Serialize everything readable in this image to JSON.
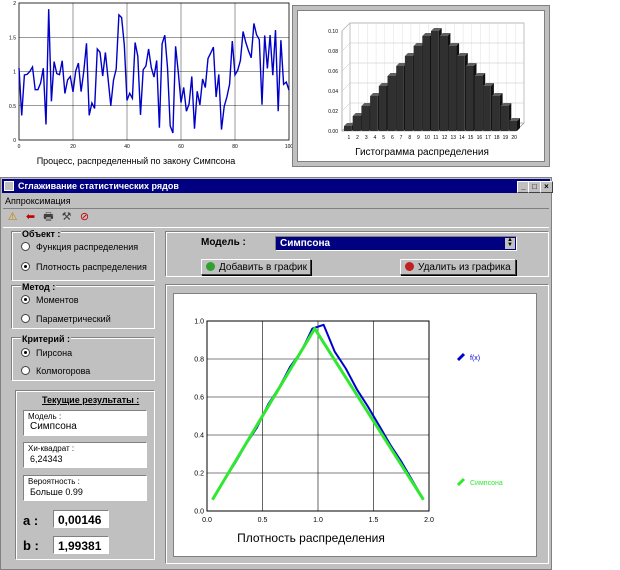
{
  "process_chart": {
    "caption": "Процесс, распределенный по закону Симпсона",
    "yticks": [
      "0",
      "0.5",
      "1",
      "1.5",
      "2"
    ],
    "xticks": [
      "0",
      "20",
      "40",
      "60",
      "80",
      "100"
    ],
    "line_color": "#0000c8"
  },
  "histogram": {
    "caption": "Гистограмма распределения",
    "yticks": [
      "0.00",
      "0.02",
      "0.04",
      "0.06",
      "0.08",
      "0.10"
    ],
    "xticks": [
      "1",
      "2",
      "3",
      "4",
      "5",
      "6",
      "7",
      "8",
      "9",
      "10",
      "11",
      "12",
      "13",
      "14",
      "15",
      "16",
      "17",
      "18",
      "19",
      "20"
    ]
  },
  "window": {
    "title": "Сглаживание статистических рядов",
    "menu": [
      "Аппроксимация"
    ],
    "toolbar_icons": [
      "warning-icon",
      "back-arrow-icon",
      "print-icon",
      "tools-icon",
      "stop-icon"
    ],
    "controls": {
      "minimize": "_",
      "maximize": "□",
      "close": "×"
    }
  },
  "object_group": {
    "title": "Объект :",
    "options": [
      "Функция распределения",
      "Плотность распределения"
    ],
    "selected": 1
  },
  "method_group": {
    "title": "Метод :",
    "options": [
      "Моментов",
      "Параметрический"
    ],
    "selected": 0
  },
  "criterion_group": {
    "title": "Критерий :",
    "options": [
      "Пирсона",
      "Колмогорова"
    ],
    "selected": 0
  },
  "results": {
    "title": "Текущие результаты :",
    "model_label": "Модель :",
    "model_value": "Симпсона",
    "chi_label": "Хи-квадрат :",
    "chi_value": "6,24343",
    "prob_label": "Вероятность :",
    "prob_value": "Больше 0.99",
    "a_label": "a :",
    "a_value": "0,00146",
    "b_label": "b :",
    "b_value": "1,99381"
  },
  "model_bar": {
    "label": "Модель :",
    "selected": "Симпсона",
    "add_button": "Добавить в график",
    "remove_button": "Удалить из графика"
  },
  "chart_data": {
    "type": "line",
    "title": "Плотность распределения",
    "xlim": [
      0,
      2
    ],
    "ylim": [
      0,
      1
    ],
    "xticks": [
      "0.0",
      "0.5",
      "1.0",
      "1.5",
      "2.0"
    ],
    "yticks": [
      "0.0",
      "0.2",
      "0.4",
      "0.6",
      "0.8",
      "1.0"
    ],
    "grid": true,
    "series": [
      {
        "name": "f(x)",
        "color": "#0000d0",
        "x": [
          0.05,
          0.15,
          0.25,
          0.35,
          0.45,
          0.55,
          0.65,
          0.75,
          0.85,
          0.95,
          1.05,
          1.15,
          1.25,
          1.35,
          1.45,
          1.55,
          1.65,
          1.75,
          1.85,
          1.95
        ],
        "y": [
          0.06,
          0.16,
          0.25,
          0.35,
          0.44,
          0.56,
          0.65,
          0.76,
          0.84,
          0.96,
          0.98,
          0.84,
          0.75,
          0.64,
          0.55,
          0.45,
          0.35,
          0.26,
          0.16,
          0.06
        ]
      },
      {
        "name": "Симпсона",
        "color": "#30e830",
        "x": [
          0.05,
          0.97,
          1.95
        ],
        "y": [
          0.06,
          0.96,
          0.06
        ]
      }
    ]
  }
}
